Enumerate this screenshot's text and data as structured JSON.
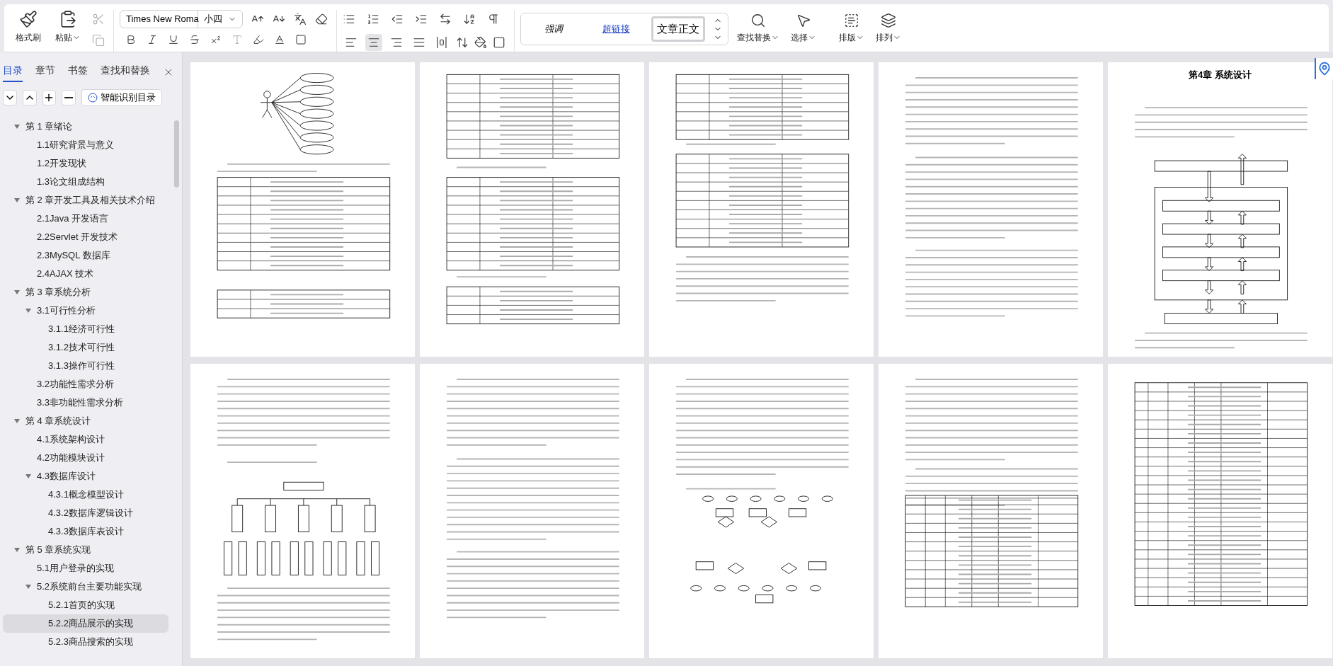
{
  "ribbon": {
    "clipboard": [
      {
        "label": "格式刷",
        "kind": "format-painter",
        "dropdown": false
      },
      {
        "label": "粘贴",
        "kind": "paste",
        "dropdown": true
      }
    ],
    "font": {
      "name": "Times New Roma",
      "size": "小四"
    },
    "alignment": [
      {
        "kind": "left",
        "selected": false
      },
      {
        "kind": "center",
        "selected": true
      },
      {
        "kind": "right",
        "selected": false
      },
      {
        "kind": "justify",
        "selected": false
      },
      {
        "kind": "distributed",
        "selected": false
      }
    ],
    "styles": [
      {
        "label": "强调",
        "kind": "emphasis",
        "selected": false
      },
      {
        "label": "超链接",
        "kind": "link",
        "selected": false
      },
      {
        "label": "文章正文",
        "kind": "body",
        "selected": true
      }
    ],
    "tools": [
      {
        "label": "查找替换",
        "kind": "search"
      },
      {
        "label": "选择",
        "kind": "select"
      },
      {
        "label": "排版",
        "kind": "layout"
      },
      {
        "label": "排列",
        "kind": "arrange"
      }
    ]
  },
  "nav": {
    "tabs": [
      {
        "label": "目录",
        "selected": true
      },
      {
        "label": "章节",
        "selected": false
      },
      {
        "label": "书签",
        "selected": false
      },
      {
        "label": "查找和替换",
        "selected": false
      }
    ],
    "smart_button": "智能识别目录",
    "toc": [
      {
        "label": "第 1 章绪论",
        "expanded": true,
        "selected": false,
        "children": [
          {
            "label": "1.1研究背景与意义",
            "selected": false
          },
          {
            "label": "1.2开发现状",
            "selected": false
          },
          {
            "label": "1.3论文组成结构",
            "selected": false
          }
        ]
      },
      {
        "label": "第 2 章开发工具及相关技术介绍",
        "expanded": true,
        "selected": false,
        "children": [
          {
            "label": "2.1Java 开发语言",
            "selected": false
          },
          {
            "label": "2.2Servlet 开发技术",
            "selected": false
          },
          {
            "label": "2.3MySQL 数据库",
            "selected": false
          },
          {
            "label": "2.4AJAX 技术",
            "selected": false
          }
        ]
      },
      {
        "label": "第 3 章系统分析",
        "expanded": true,
        "selected": false,
        "children": [
          {
            "label": "3.1可行性分析",
            "expanded": true,
            "selected": false,
            "children": [
              {
                "label": "3.1.1经济可行性",
                "selected": false
              },
              {
                "label": "3.1.2技术可行性",
                "selected": false
              },
              {
                "label": "3.1.3操作可行性",
                "selected": false
              }
            ]
          },
          {
            "label": "3.2功能性需求分析",
            "selected": false
          },
          {
            "label": "3.3非功能性需求分析",
            "selected": false
          }
        ]
      },
      {
        "label": "第 4 章系统设计",
        "expanded": true,
        "selected": false,
        "children": [
          {
            "label": "4.1系统架构设计",
            "selected": false
          },
          {
            "label": "4.2功能模块设计",
            "selected": false
          },
          {
            "label": "4.3数据库设计",
            "expanded": true,
            "selected": false,
            "children": [
              {
                "label": "4.3.1概念模型设计",
                "selected": false
              },
              {
                "label": "4.3.2数据库逻辑设计",
                "selected": false
              },
              {
                "label": "4.3.3数据库表设计",
                "selected": false
              }
            ]
          }
        ]
      },
      {
        "label": "第 5 章系统实现",
        "expanded": true,
        "selected": false,
        "children": [
          {
            "label": "5.1用户登录的实现",
            "selected": false
          },
          {
            "label": "5.2系统前台主要功能实现",
            "expanded": true,
            "selected": false,
            "children": [
              {
                "label": "5.2.1首页的实现",
                "selected": false
              },
              {
                "label": "5.2.2商品展示的实现",
                "selected": true
              },
              {
                "label": "5.2.3商品搜索的实现",
                "selected": false
              }
            ]
          }
        ]
      }
    ]
  },
  "pages": [
    {
      "kind": "usecase"
    },
    {
      "kind": "tables"
    },
    {
      "kind": "tables-text"
    },
    {
      "kind": "text"
    },
    {
      "kind": "architecture",
      "heading": "第4章  系统设计"
    },
    {
      "kind": "tree"
    },
    {
      "kind": "text"
    },
    {
      "kind": "er"
    },
    {
      "kind": "text-table"
    },
    {
      "kind": "table"
    }
  ]
}
